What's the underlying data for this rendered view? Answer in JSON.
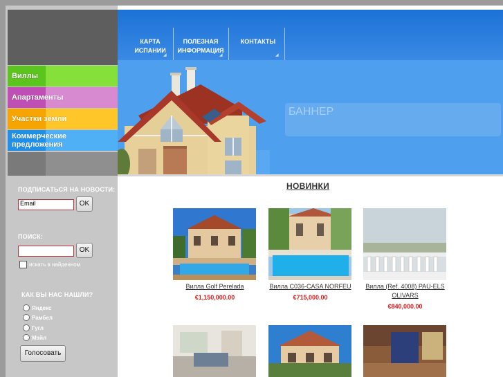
{
  "nav": {
    "items": [
      {
        "label_line1": "КАРТА",
        "label_line2": "ИСПАНИИ"
      },
      {
        "label_line1": "ПОЛЕЗНАЯ",
        "label_line2": "ИНФОРМАЦИЯ"
      },
      {
        "label_line1": "КОНТАКТЫ",
        "label_line2": ""
      }
    ]
  },
  "banner": {
    "text": "БАННЕР"
  },
  "sidebar": {
    "menu": [
      {
        "label": "Виллы",
        "color": "#5bc41d"
      },
      {
        "label": "Апартаменты",
        "color": "#c04fb5"
      },
      {
        "label": "Участки земли",
        "color": "#f5a400"
      },
      {
        "label": "Коммерческие предложения",
        "color": "#1f8fe8"
      }
    ],
    "subscribe": {
      "label": "ПОДПИСАТЬСЯ НА НОВОСТИ:",
      "value": "Email",
      "button": "OK"
    },
    "search": {
      "label": "ПОИСК:",
      "value": "",
      "button": "OK",
      "checkbox_label": "искать в найденном"
    },
    "poll": {
      "label": "КАК ВЫ НАС НАШЛИ?",
      "options": [
        "Яндекс",
        "Рамбел",
        "Гугл",
        "Мэйл"
      ],
      "button": "Голосовать"
    }
  },
  "main": {
    "title": "НОВИНКИ",
    "listings": [
      {
        "name": "Вилла Golf Perelada",
        "price": "€1,150,000.00"
      },
      {
        "name": "Вилла C036-CASA NORFEU",
        "price": "€715,000.00"
      },
      {
        "name": "Вилла (Ref. 4008) PAU-ELS OLIVARS",
        "price": "€840,000.00"
      }
    ]
  }
}
